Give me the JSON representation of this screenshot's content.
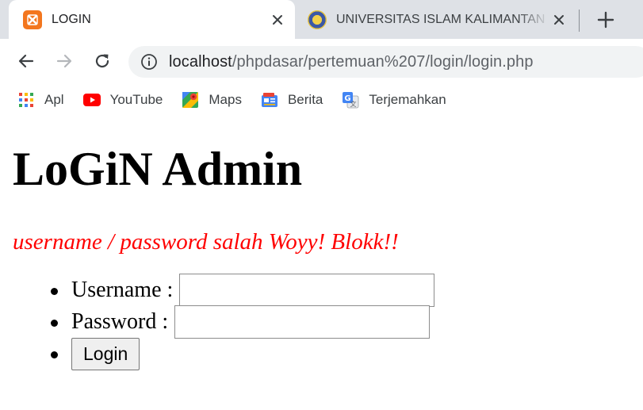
{
  "tabs": [
    {
      "title": "LOGIN",
      "favicon": "xampp-icon",
      "active": true
    },
    {
      "title": "UNIVERSITAS ISLAM KALIMANTAN",
      "favicon": "university-seal-icon",
      "active": false
    }
  ],
  "toolbar": {
    "url_host": "localhost",
    "url_path": "/phpdasar/pertemuan%207/login/login.php",
    "icons": [
      "back-icon",
      "forward-icon",
      "reload-icon",
      "info-icon"
    ]
  },
  "bookmarks": [
    {
      "label": "Apl",
      "icon": "apps-grid-icon"
    },
    {
      "label": "YouTube",
      "icon": "youtube-icon"
    },
    {
      "label": "Maps",
      "icon": "maps-icon"
    },
    {
      "label": "Berita",
      "icon": "news-icon"
    },
    {
      "label": "Terjemahkan",
      "icon": "translate-icon"
    }
  ],
  "page": {
    "title": "LoGiN Admin",
    "error": "username / password salah Woyy! Blokk!!",
    "username_label": "Username :",
    "password_label": "Password :",
    "username_value": "",
    "password_value": "",
    "login_button": "Login"
  },
  "colors": {
    "tabstrip": "#dee1e6",
    "omnibox": "#f1f3f4",
    "error": "#ff0000",
    "xampp": "#f3761e"
  }
}
